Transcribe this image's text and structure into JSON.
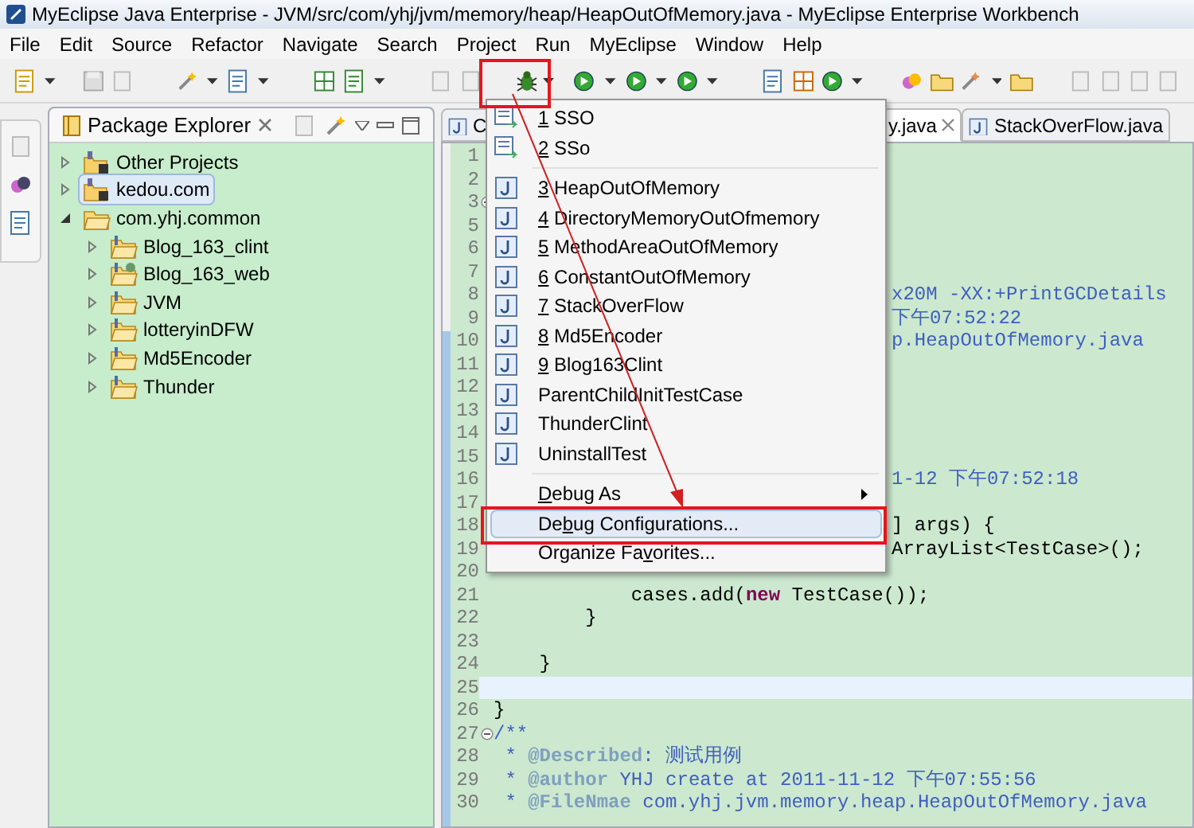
{
  "window": {
    "title": "MyEclipse Java Enterprise - JVM/src/com/yhj/jvm/memory/heap/HeapOutOfMemory.java - MyEclipse Enterprise Workbench"
  },
  "menu_bar": [
    "File",
    "Edit",
    "Source",
    "Refactor",
    "Navigate",
    "Search",
    "Project",
    "Run",
    "MyEclipse",
    "Window",
    "Help"
  ],
  "package_explorer": {
    "title": "Package Explorer",
    "tree": [
      {
        "label": "Other Projects",
        "kind": "working-set",
        "expanded": false,
        "selected": false
      },
      {
        "label": "kedou.com",
        "kind": "working-set",
        "expanded": false,
        "selected": true
      },
      {
        "label": "com.yhj.common",
        "kind": "folder",
        "expanded": true,
        "selected": false,
        "children": [
          {
            "label": "Blog_163_clint",
            "kind": "project",
            "expanded": false,
            "selected": false
          },
          {
            "label": "Blog_163_web",
            "kind": "web-project",
            "expanded": false,
            "selected": false
          },
          {
            "label": "JVM",
            "kind": "project",
            "expanded": false,
            "selected": false
          },
          {
            "label": "lotteryinDFW",
            "kind": "project",
            "expanded": false,
            "selected": false
          },
          {
            "label": "Md5Encoder",
            "kind": "project",
            "expanded": false,
            "selected": false
          },
          {
            "label": "Thunder",
            "kind": "project",
            "expanded": false,
            "selected": false
          }
        ]
      }
    ]
  },
  "editor": {
    "tabs": [
      {
        "label": "C",
        "selected": false
      },
      {
        "label": "y.java",
        "selected": true
      },
      {
        "label": "StackOverFlow.java",
        "selected": false
      }
    ],
    "lines": [
      {
        "number": "1",
        "fold": false,
        "current": false
      },
      {
        "number": "2",
        "fold": false,
        "current": false
      },
      {
        "number": "3",
        "fold": true,
        "current": false
      },
      {
        "number": "5",
        "fold": false,
        "current": false
      },
      {
        "number": "6",
        "fold": false,
        "current": false
      },
      {
        "number": "7",
        "fold": false,
        "current": false
      },
      {
        "number": "8",
        "fold": false,
        "current": false,
        "text_right": {
          "kind": "comment",
          "text": "x20M -XX:+PrintGCDetails"
        }
      },
      {
        "number": "9",
        "fold": false,
        "current": false,
        "text_right": {
          "kind": "comment",
          "text": "下午07:52:22"
        }
      },
      {
        "number": "10",
        "fold": false,
        "current": false,
        "text_right": {
          "kind": "comment",
          "text": "p.HeapOutOfMemory.java"
        }
      },
      {
        "number": "11",
        "fold": false,
        "current": false
      },
      {
        "number": "12",
        "fold": false,
        "current": false
      },
      {
        "number": "13",
        "fold": false,
        "current": false
      },
      {
        "number": "14",
        "fold": false,
        "current": false
      },
      {
        "number": "15",
        "fold": false,
        "current": false
      },
      {
        "number": "16",
        "fold": false,
        "current": false,
        "text_right": {
          "kind": "comment",
          "text": "1-12 下午07:52:18"
        }
      },
      {
        "number": "17",
        "fold": false,
        "current": false
      },
      {
        "number": "18",
        "fold": false,
        "current": false,
        "text_right": {
          "kind": "code",
          "text": "] args) {"
        }
      },
      {
        "number": "19",
        "fold": false,
        "current": false,
        "text_right": {
          "kind": "code",
          "text": "ArrayList<TestCase>();"
        }
      },
      {
        "number": "20",
        "fold": false,
        "current": false
      },
      {
        "number": "21",
        "fold": false,
        "current": false,
        "segments": [
          {
            "kind": "code",
            "text": "            cases.add("
          },
          {
            "kind": "keyword",
            "text": "new"
          },
          {
            "kind": "code",
            "text": " TestCase());"
          }
        ]
      },
      {
        "number": "22",
        "fold": false,
        "current": false,
        "segments": [
          {
            "kind": "code",
            "text": "        }"
          }
        ]
      },
      {
        "number": "23",
        "fold": false,
        "current": false
      },
      {
        "number": "24",
        "fold": false,
        "current": false,
        "segments": [
          {
            "kind": "code",
            "text": "    }"
          }
        ]
      },
      {
        "number": "25",
        "fold": false,
        "current": true
      },
      {
        "number": "26",
        "fold": false,
        "current": false,
        "segments": [
          {
            "kind": "code",
            "text": "}"
          }
        ]
      },
      {
        "number": "27",
        "fold": true,
        "current": false,
        "segments": [
          {
            "kind": "comment",
            "text": "/**"
          }
        ]
      },
      {
        "number": "28",
        "fold": false,
        "current": false,
        "segments": [
          {
            "kind": "comment",
            "text": " * "
          },
          {
            "kind": "tag",
            "text": "@Described"
          },
          {
            "kind": "comment",
            "text": ": 测试用例"
          }
        ]
      },
      {
        "number": "29",
        "fold": false,
        "current": false,
        "segments": [
          {
            "kind": "comment",
            "text": " * "
          },
          {
            "kind": "tag",
            "text": "@author"
          },
          {
            "kind": "comment",
            "text": " YHJ create at 2011-11-12 下午07:55:56"
          }
        ]
      },
      {
        "number": "30",
        "fold": false,
        "current": false,
        "segments": [
          {
            "kind": "comment",
            "text": " * "
          },
          {
            "kind": "tag",
            "text": "@FileNmae"
          },
          {
            "kind": "comment",
            "text": " com.yhj.jvm.memory.heap.HeapOutOfMemory.java"
          }
        ]
      }
    ]
  },
  "debug_menu": [
    {
      "kind": "launch",
      "selected": false,
      "submenu": false,
      "parts": [
        {
          "text": "1",
          "mnemonic": true
        },
        {
          "text": " SSO",
          "mnemonic": false
        }
      ]
    },
    {
      "kind": "launch",
      "selected": false,
      "submenu": false,
      "parts": [
        {
          "text": "2",
          "mnemonic": true
        },
        {
          "text": " SSo",
          "mnemonic": false
        }
      ]
    },
    {
      "kind": "separator"
    },
    {
      "kind": "java",
      "selected": false,
      "submenu": false,
      "parts": [
        {
          "text": "3",
          "mnemonic": true
        },
        {
          "text": " HeapOutOfMemory",
          "mnemonic": false
        }
      ]
    },
    {
      "kind": "java",
      "selected": false,
      "submenu": false,
      "parts": [
        {
          "text": "4",
          "mnemonic": true
        },
        {
          "text": " DirectoryMemoryOutOfmemory",
          "mnemonic": false
        }
      ]
    },
    {
      "kind": "java",
      "selected": false,
      "submenu": false,
      "parts": [
        {
          "text": "5",
          "mnemonic": true
        },
        {
          "text": " MethodAreaOutOfMemory",
          "mnemonic": false
        }
      ]
    },
    {
      "kind": "java",
      "selected": false,
      "submenu": false,
      "parts": [
        {
          "text": "6",
          "mnemonic": true
        },
        {
          "text": " ConstantOutOfMemory",
          "mnemonic": false
        }
      ]
    },
    {
      "kind": "java",
      "selected": false,
      "submenu": false,
      "parts": [
        {
          "text": "7",
          "mnemonic": true
        },
        {
          "text": " StackOverFlow",
          "mnemonic": false
        }
      ]
    },
    {
      "kind": "java",
      "selected": false,
      "submenu": false,
      "parts": [
        {
          "text": "8",
          "mnemonic": true
        },
        {
          "text": " Md5Encoder",
          "mnemonic": false
        }
      ]
    },
    {
      "kind": "java",
      "selected": false,
      "submenu": false,
      "parts": [
        {
          "text": "9",
          "mnemonic": true
        },
        {
          "text": " Blog163Clint",
          "mnemonic": false
        }
      ]
    },
    {
      "kind": "java",
      "selected": false,
      "submenu": false,
      "parts": [
        {
          "text": "ParentChildInitTestCase",
          "mnemonic": false
        }
      ]
    },
    {
      "kind": "java",
      "selected": false,
      "submenu": false,
      "parts": [
        {
          "text": "ThunderClint",
          "mnemonic": false
        }
      ]
    },
    {
      "kind": "java",
      "selected": false,
      "submenu": false,
      "parts": [
        {
          "text": "UninstallTest",
          "mnemonic": false
        }
      ]
    },
    {
      "kind": "separator"
    },
    {
      "kind": "plain",
      "selected": false,
      "submenu": true,
      "parts": [
        {
          "text": "D",
          "mnemonic": true
        },
        {
          "text": "ebug As",
          "mnemonic": false
        }
      ]
    },
    {
      "kind": "plain",
      "selected": true,
      "submenu": false,
      "parts": [
        {
          "text": "De",
          "mnemonic": false
        },
        {
          "text": "b",
          "mnemonic": true
        },
        {
          "text": "ug Configurations...",
          "mnemonic": false
        }
      ]
    },
    {
      "kind": "plain",
      "selected": false,
      "submenu": false,
      "parts": [
        {
          "text": "Organize Fa",
          "mnemonic": false
        },
        {
          "text": "v",
          "mnemonic": true
        },
        {
          "text": "orites...",
          "mnemonic": false
        }
      ]
    }
  ]
}
